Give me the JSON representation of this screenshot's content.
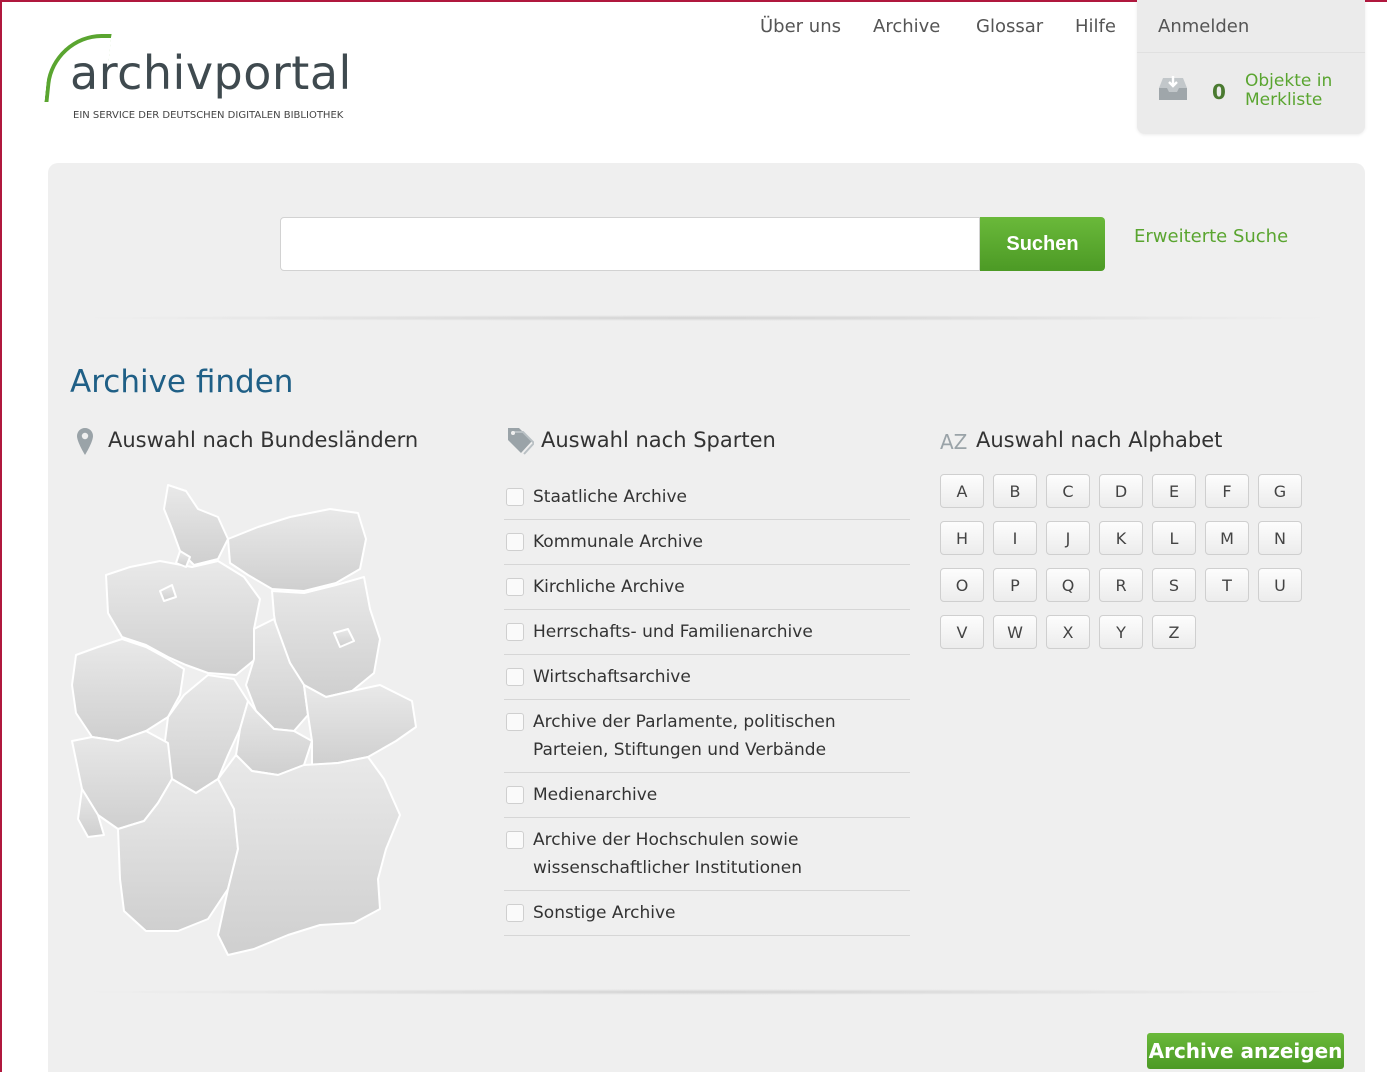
{
  "header": {
    "logo_text": "archivportal",
    "logo_subtitle": "EIN SERVICE DER DEUTSCHEN DIGITALEN BIBLIOTHEK",
    "nav": [
      "Über uns",
      "Archive",
      "Glossar",
      "Hilfe"
    ],
    "login_label": "Anmelden",
    "basket": {
      "count": "0",
      "label_line1": "Objekte in",
      "label_line2": "Merkliste",
      "icon": "inbox-icon"
    }
  },
  "search": {
    "placeholder": "",
    "value": "",
    "button_label": "Suchen",
    "advanced_label": "Erweiterte Suche"
  },
  "finder": {
    "title": "Archive finden",
    "states_heading": "Auswahl nach Bundesländern",
    "states_icon": "map-pin-icon",
    "map_icon": "germany-map",
    "sectors_heading": "Auswahl nach Sparten",
    "sectors_icon": "tag-icon",
    "sectors": [
      "Staatliche Archive",
      "Kommunale Archive",
      "Kirchliche Archive",
      "Herrschafts- und Familienarchive",
      "Wirtschaftsarchive",
      "Archive der Parlamente, politischen Parteien, Stiftungen und Verbände",
      "Medienarchive",
      "Archive der Hochschulen sowie wissenschaftlicher Institutionen",
      "Sonstige Archive"
    ],
    "alphabet_heading": "Auswahl nach Alphabet",
    "alphabet_icon_text": "AZ",
    "letters": [
      "A",
      "B",
      "C",
      "D",
      "E",
      "F",
      "G",
      "H",
      "I",
      "J",
      "K",
      "L",
      "M",
      "N",
      "O",
      "P",
      "Q",
      "R",
      "S",
      "T",
      "U",
      "V",
      "W",
      "X",
      "Y",
      "Z"
    ],
    "show_button": "Archive anzeigen"
  },
  "colors": {
    "accent_green": "#5aa530",
    "button_green": "#4c9a25",
    "title_blue": "#1f5f86",
    "frame_red": "#b0183e"
  }
}
